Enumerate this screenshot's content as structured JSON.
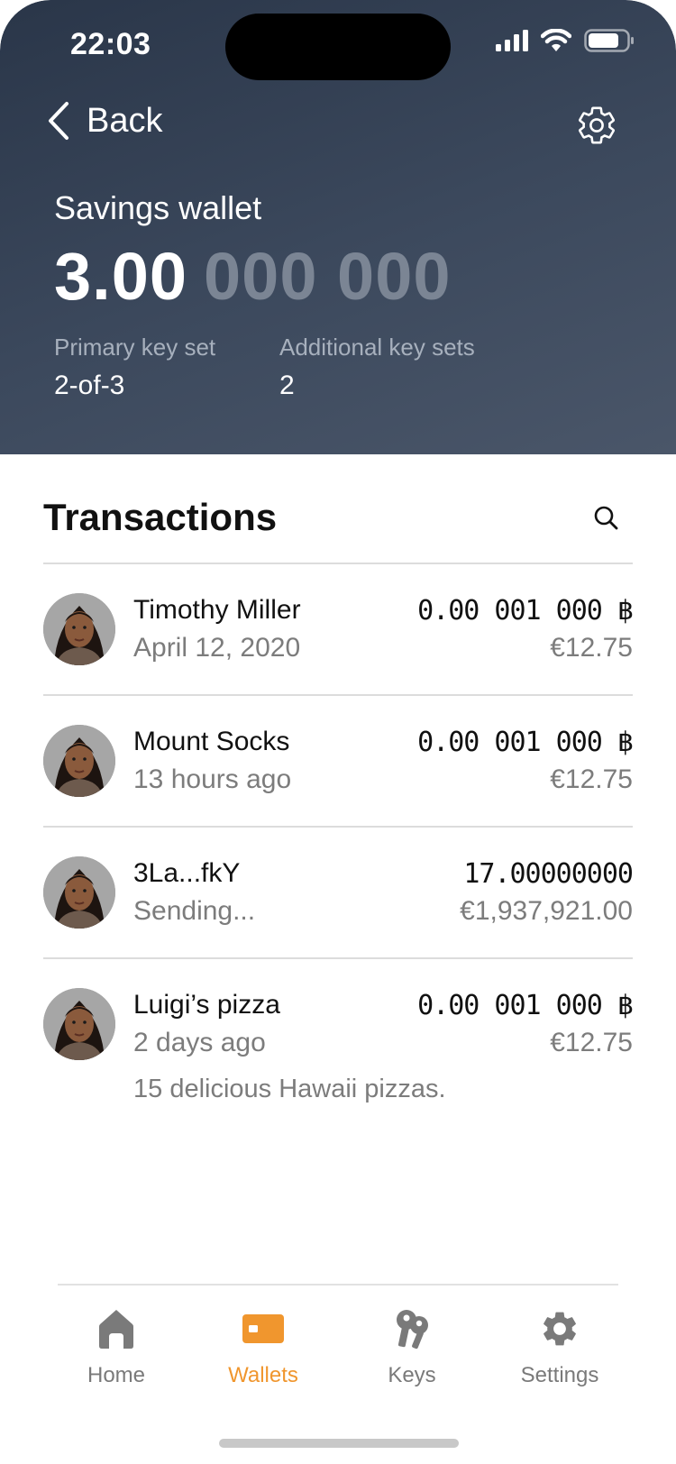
{
  "status_bar": {
    "time": "22:03"
  },
  "nav": {
    "back_label": "Back"
  },
  "wallet": {
    "title": "Savings wallet",
    "balance_main": "3.00",
    "balance_dim": "000 000",
    "primary_key_label": "Primary key set",
    "primary_key_value": "2-of-3",
    "additional_key_label": "Additional key sets",
    "additional_key_value": "2"
  },
  "transactions": {
    "heading": "Transactions",
    "items": [
      {
        "name": "Timothy Miller",
        "sub": "April 12, 2020",
        "amount": "0.00 001 000 ฿",
        "fiat": "€12.75",
        "note": ""
      },
      {
        "name": "Mount Socks",
        "sub": "13 hours ago",
        "amount": "0.00 001 000 ฿",
        "fiat": "€12.75",
        "note": ""
      },
      {
        "name": "3La...fkY",
        "sub": "Sending...",
        "amount": "17.00000000",
        "fiat": "€1,937,921.00",
        "note": ""
      },
      {
        "name": "Luigi’s pizza",
        "sub": "2 days ago",
        "amount": "0.00 001 000 ฿",
        "fiat": "€12.75",
        "note": "15 delicious Hawaii pizzas."
      }
    ]
  },
  "tabbar": {
    "accent_color": "#f0962e",
    "tabs": [
      {
        "label": "Home",
        "icon": "home-icon"
      },
      {
        "label": "Wallets",
        "icon": "wallet-icon",
        "active": true
      },
      {
        "label": "Keys",
        "icon": "keys-icon"
      },
      {
        "label": "Settings",
        "icon": "settings-icon"
      }
    ]
  }
}
